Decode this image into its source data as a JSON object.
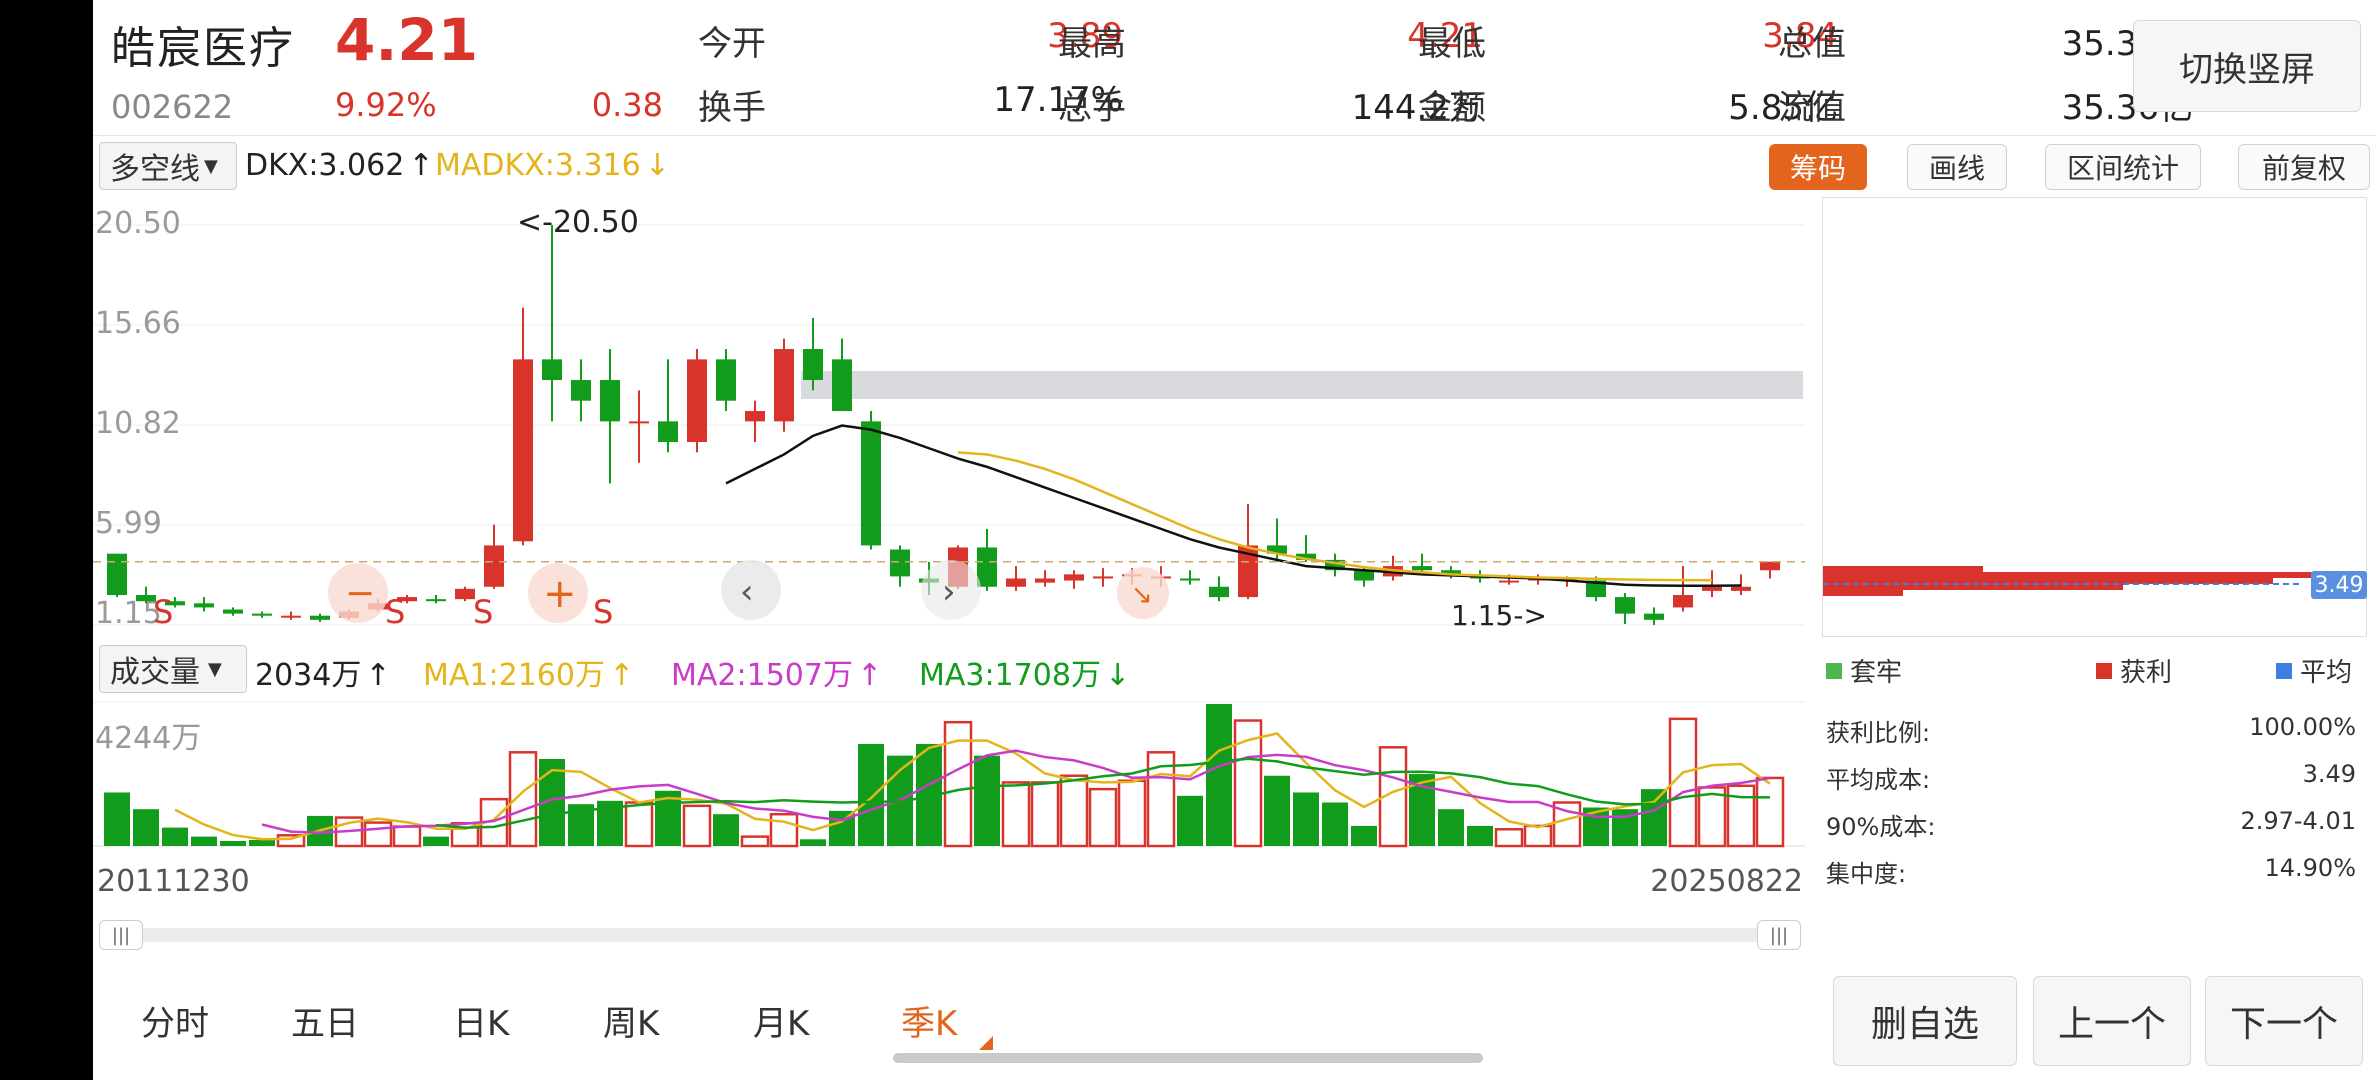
{
  "stock": {
    "name": "皓宸医疗",
    "price": "4.21",
    "code": "002622",
    "change_pct": "9.92%",
    "change_amt": "0.38"
  },
  "quote": {
    "open_label": "今开",
    "open": "3.89",
    "high_label": "最高",
    "high": "4.21",
    "low_label": "最低",
    "low": "3.84",
    "mcap_label": "总值",
    "mcap": "35.36亿",
    "turnover_label": "换手",
    "turnover": "17.17%",
    "volume_label": "总手",
    "volume": "144.2万",
    "amount_label": "金额",
    "amount": "5.85亿",
    "float_label": "流值",
    "float_cap": "35.36亿"
  },
  "toolbar": {
    "switch_portrait": "切换竖屏",
    "indicator": "多空线",
    "dkx": "DKX:3.062",
    "madkx": "MADKX:3.316",
    "chips": "筹码",
    "draw_line": "画线",
    "range_stats": "区间统计",
    "adjust": "前复权"
  },
  "chart_data": {
    "type": "candlestick",
    "period": "quarterly",
    "y_ticks": [
      "20.50",
      "15.66",
      "10.82",
      "5.99",
      "1.15"
    ],
    "ylim": [
      1.15,
      20.5
    ],
    "high_annotation": "<-20.50",
    "low_annotation": "1.15->",
    "current_price_line": 4.21,
    "candles": [
      {
        "o": 4.6,
        "h": 4.6,
        "l": 2.5,
        "c": 2.6
      },
      {
        "o": 2.6,
        "h": 3.0,
        "l": 2.2,
        "c": 2.3
      },
      {
        "o": 2.3,
        "h": 2.5,
        "l": 2.0,
        "c": 2.1
      },
      {
        "o": 2.2,
        "h": 2.5,
        "l": 1.8,
        "c": 2.0
      },
      {
        "o": 1.9,
        "h": 2.0,
        "l": 1.6,
        "c": 1.7
      },
      {
        "o": 1.7,
        "h": 1.8,
        "l": 1.5,
        "c": 1.6
      },
      {
        "o": 1.6,
        "h": 1.8,
        "l": 1.4,
        "c": 1.6
      },
      {
        "o": 1.6,
        "h": 1.7,
        "l": 1.3,
        "c": 1.4
      },
      {
        "o": 1.5,
        "h": 1.9,
        "l": 1.4,
        "c": 1.8
      },
      {
        "o": 1.9,
        "h": 2.4,
        "l": 1.8,
        "c": 2.2
      },
      {
        "o": 2.3,
        "h": 2.6,
        "l": 2.2,
        "c": 2.5
      },
      {
        "o": 2.4,
        "h": 2.6,
        "l": 2.2,
        "c": 2.3
      },
      {
        "o": 2.4,
        "h": 3.0,
        "l": 2.3,
        "c": 2.9
      },
      {
        "o": 3.0,
        "h": 6.0,
        "l": 2.9,
        "c": 5.0
      },
      {
        "o": 5.2,
        "h": 16.5,
        "l": 5.0,
        "c": 14.0
      },
      {
        "o": 14.0,
        "h": 20.5,
        "l": 11.0,
        "c": 13.0
      },
      {
        "o": 13.0,
        "h": 14.0,
        "l": 11.0,
        "c": 12.0
      },
      {
        "o": 13.0,
        "h": 14.5,
        "l": 8.0,
        "c": 11.0
      },
      {
        "o": 11.0,
        "h": 12.5,
        "l": 9.0,
        "c": 11.0
      },
      {
        "o": 11.0,
        "h": 14.0,
        "l": 9.5,
        "c": 10.0
      },
      {
        "o": 10.0,
        "h": 14.5,
        "l": 9.5,
        "c": 14.0
      },
      {
        "o": 14.0,
        "h": 14.5,
        "l": 11.5,
        "c": 12.0
      },
      {
        "o": 11.0,
        "h": 12.0,
        "l": 10.0,
        "c": 11.5
      },
      {
        "o": 11.0,
        "h": 15.0,
        "l": 10.5,
        "c": 14.5
      },
      {
        "o": 14.5,
        "h": 16.0,
        "l": 12.5,
        "c": 13.0
      },
      {
        "o": 14.0,
        "h": 15.0,
        "l": 11.5,
        "c": 11.5
      },
      {
        "o": 11.0,
        "h": 11.5,
        "l": 4.8,
        "c": 5.0
      },
      {
        "o": 4.8,
        "h": 5.0,
        "l": 3.0,
        "c": 3.5
      },
      {
        "o": 3.4,
        "h": 4.2,
        "l": 2.6,
        "c": 3.2
      },
      {
        "o": 3.0,
        "h": 5.0,
        "l": 2.9,
        "c": 4.9
      },
      {
        "o": 4.9,
        "h": 5.8,
        "l": 2.8,
        "c": 3.0
      },
      {
        "o": 3.0,
        "h": 4.0,
        "l": 2.8,
        "c": 3.4
      },
      {
        "o": 3.2,
        "h": 3.8,
        "l": 3.0,
        "c": 3.4
      },
      {
        "o": 3.3,
        "h": 3.8,
        "l": 2.9,
        "c": 3.6
      },
      {
        "o": 3.4,
        "h": 3.9,
        "l": 3.0,
        "c": 3.5
      },
      {
        "o": 3.5,
        "h": 3.9,
        "l": 3.1,
        "c": 3.6
      },
      {
        "o": 3.4,
        "h": 4.0,
        "l": 3.0,
        "c": 3.5
      },
      {
        "o": 3.4,
        "h": 3.8,
        "l": 3.1,
        "c": 3.3
      },
      {
        "o": 3.0,
        "h": 3.5,
        "l": 2.3,
        "c": 2.5
      },
      {
        "o": 2.5,
        "h": 7.0,
        "l": 2.4,
        "c": 5.0
      },
      {
        "o": 5.0,
        "h": 6.3,
        "l": 4.2,
        "c": 4.6
      },
      {
        "o": 4.6,
        "h": 5.5,
        "l": 4.2,
        "c": 4.3
      },
      {
        "o": 4.3,
        "h": 4.6,
        "l": 3.5,
        "c": 3.8
      },
      {
        "o": 3.8,
        "h": 4.0,
        "l": 3.0,
        "c": 3.3
      },
      {
        "o": 3.5,
        "h": 4.5,
        "l": 3.3,
        "c": 4.0
      },
      {
        "o": 4.0,
        "h": 4.6,
        "l": 3.6,
        "c": 3.8
      },
      {
        "o": 3.8,
        "h": 4.0,
        "l": 3.4,
        "c": 3.6
      },
      {
        "o": 3.5,
        "h": 3.8,
        "l": 3.2,
        "c": 3.4
      },
      {
        "o": 3.3,
        "h": 3.6,
        "l": 3.1,
        "c": 3.3
      },
      {
        "o": 3.3,
        "h": 3.6,
        "l": 3.1,
        "c": 3.4
      },
      {
        "o": 3.3,
        "h": 3.5,
        "l": 3.0,
        "c": 3.4
      },
      {
        "o": 3.3,
        "h": 3.5,
        "l": 2.3,
        "c": 2.5
      },
      {
        "o": 2.5,
        "h": 2.7,
        "l": 1.2,
        "c": 1.7
      },
      {
        "o": 1.7,
        "h": 2.0,
        "l": 1.15,
        "c": 1.4
      },
      {
        "o": 2.0,
        "h": 4.0,
        "l": 1.8,
        "c": 2.6
      },
      {
        "o": 2.8,
        "h": 3.8,
        "l": 2.5,
        "c": 3.0
      },
      {
        "o": 2.8,
        "h": 3.6,
        "l": 2.6,
        "c": 3.0
      },
      {
        "o": 3.8,
        "h": 4.21,
        "l": 3.4,
        "c": 4.21
      }
    ],
    "dkx_line": [
      null,
      null,
      null,
      null,
      null,
      null,
      null,
      null,
      null,
      null,
      null,
      null,
      null,
      null,
      null,
      null,
      null,
      null,
      null,
      null,
      null,
      8.0,
      8.7,
      9.4,
      10.3,
      10.8,
      10.6,
      10.2,
      9.7,
      9.2,
      8.8,
      8.3,
      7.8,
      7.3,
      6.8,
      6.3,
      5.8,
      5.3,
      4.9,
      4.6,
      4.3,
      4.0,
      3.9,
      3.8,
      3.7,
      3.6,
      3.55,
      3.5,
      3.45,
      3.4,
      3.3,
      3.2,
      3.1,
      3.06,
      3.05,
      3.05,
      3.06
    ],
    "madkx_line": [
      null,
      null,
      null,
      null,
      null,
      null,
      null,
      null,
      null,
      null,
      null,
      null,
      null,
      null,
      null,
      null,
      null,
      null,
      null,
      null,
      null,
      null,
      null,
      null,
      null,
      null,
      null,
      null,
      null,
      9.5,
      9.4,
      9.1,
      8.7,
      8.2,
      7.6,
      7.0,
      6.4,
      5.8,
      5.3,
      4.9,
      4.6,
      4.35,
      4.15,
      3.95,
      3.8,
      3.7,
      3.6,
      3.55,
      3.5,
      3.45,
      3.42,
      3.38,
      3.35,
      3.33,
      3.32,
      3.316
    ],
    "volume_indicator": "成交量",
    "volume_value": "2034万",
    "ma1": "MA1:2160万",
    "ma2": "MA2:1507万",
    "ma3": "MA3:1708万",
    "volume_max_label": "4244万",
    "volumes": [
      1600,
      1100,
      550,
      280,
      150,
      180,
      320,
      900,
      850,
      700,
      580,
      280,
      680,
      1400,
      2800,
      2600,
      1250,
      1350,
      1300,
      1650,
      1200,
      950,
      280,
      950,
      200,
      1050,
      3050,
      2700,
      3050,
      3700,
      2700,
      1900,
      1900,
      2100,
      1700,
      1950,
      2800,
      1500,
      4244,
      3750,
      2100,
      1600,
      1300,
      600,
      2950,
      2150,
      1100,
      600,
      500,
      600,
      1300,
      1150,
      1100,
      1700,
      3800,
      1750,
      1800,
      2034
    ],
    "x_start": "20111230",
    "x_end": "20250822"
  },
  "signals": {
    "sell": "S",
    "minus": "−",
    "plus": "+"
  },
  "chips_panel": {
    "avg_label": "3.49",
    "legend_trapped": "套牢",
    "legend_profit": "获利",
    "legend_avg": "平均",
    "stats": [
      {
        "label": "获利比例:",
        "value": "100.00%"
      },
      {
        "label": "平均成本:",
        "value": "3.49"
      },
      {
        "label": "90%成本:",
        "value": "2.97-4.01"
      },
      {
        "label": "集中度:",
        "value": "14.90%"
      }
    ]
  },
  "periods": [
    "分时",
    "五日",
    "日K",
    "周K",
    "月K",
    "季K"
  ],
  "active_period": "季K",
  "bottom_buttons": {
    "delete_watch": "删自选",
    "prev": "上一个",
    "next": "下一个"
  },
  "colors": {
    "up": "#d9342b",
    "down": "#119c1c",
    "dkx": "#111111",
    "madkx": "#e3b51a",
    "ma2": "#c93cc9",
    "accent": "#e3641c"
  }
}
